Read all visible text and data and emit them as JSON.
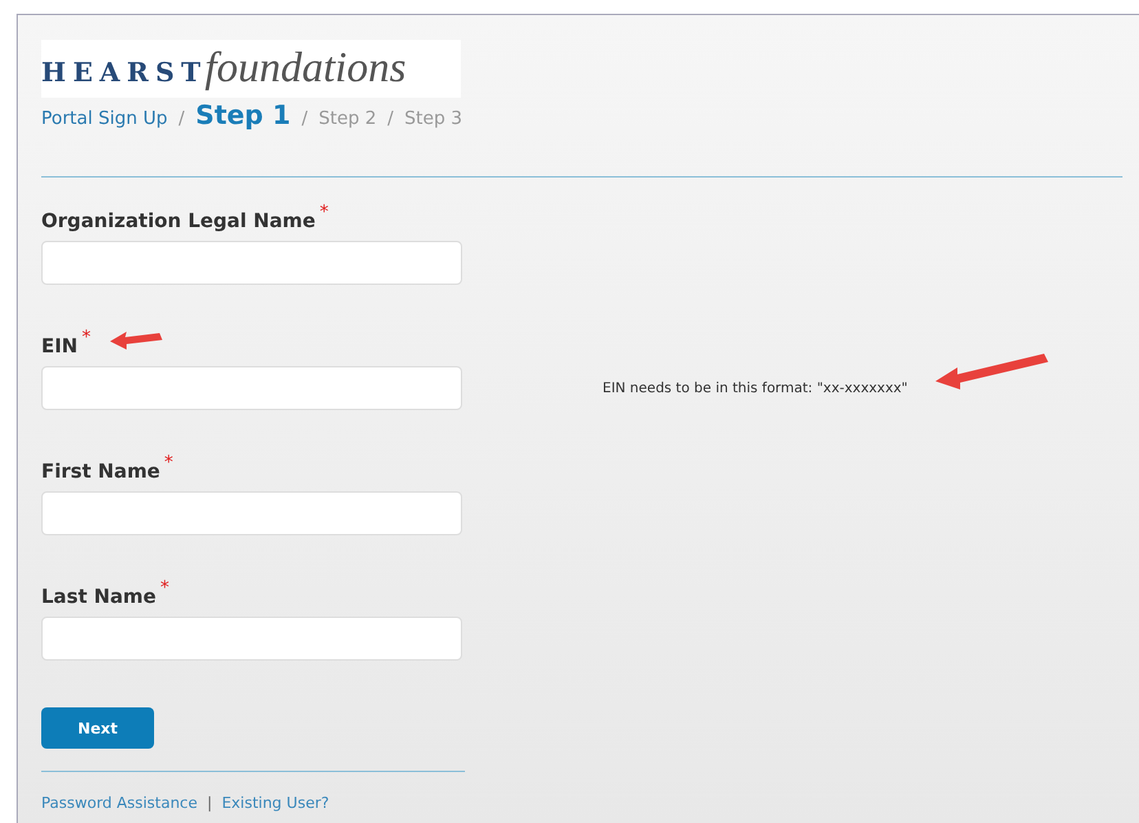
{
  "logo": {
    "bold": "HEARST",
    "script": "foundations"
  },
  "breadcrumb": [
    {
      "kind": "link",
      "text": "Portal Sign Up"
    },
    {
      "kind": "separator",
      "text": "/"
    },
    {
      "kind": "current",
      "text": "Step 1"
    },
    {
      "kind": "separator",
      "text": "/"
    },
    {
      "kind": "step",
      "text": "Step 2"
    },
    {
      "kind": "separator",
      "text": "/"
    },
    {
      "kind": "step",
      "text": "Step 3"
    }
  ],
  "fields": [
    {
      "label": "Organization Legal Name",
      "required_mark": "*",
      "arrow": false
    },
    {
      "label": "EIN",
      "required_mark": "*",
      "arrow": true,
      "hint": "EIN needs to be in this format: \"xx-xxxxxxx\""
    },
    {
      "label": "First Name",
      "required_mark": "*",
      "arrow": false
    },
    {
      "label": "Last Name",
      "required_mark": "*",
      "arrow": false
    }
  ],
  "next_button": "Next",
  "footer_links": [
    {
      "kind": "link",
      "text": "Password Assistance"
    },
    {
      "kind": "separator",
      "text": "|"
    },
    {
      "kind": "link",
      "text": "Existing User?"
    }
  ]
}
